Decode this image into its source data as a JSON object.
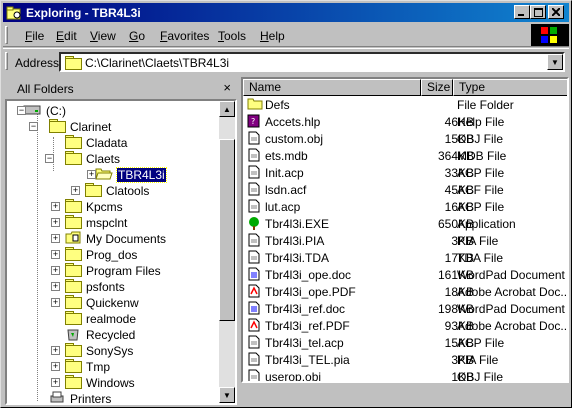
{
  "window": {
    "title": "Exploring - TBR4L3i"
  },
  "menu": [
    {
      "label": "File",
      "u": "F",
      "rest": "ile"
    },
    {
      "label": "Edit",
      "u": "E",
      "rest": "dit"
    },
    {
      "label": "View",
      "u": "V",
      "rest": "iew"
    },
    {
      "label": "Go",
      "u": "G",
      "rest": "o"
    },
    {
      "label": "Favorites",
      "u": "F",
      "rest": "avorites"
    },
    {
      "label": "Tools",
      "u": "T",
      "rest": "ools"
    },
    {
      "label": "Help",
      "u": "H",
      "rest": "elp"
    }
  ],
  "address": {
    "label": "Address",
    "value": "C:\\Clarinet\\Claets\\TBR4L3i"
  },
  "left_pane": {
    "title": "All Folders",
    "close": "×",
    "tree": [
      {
        "label": "(C:)",
        "icon": "drive-icon"
      },
      {
        "label": "Clarinet",
        "icon": "folder-icon"
      },
      {
        "label": "Cladata",
        "icon": "folder-icon"
      },
      {
        "label": "Claets",
        "icon": "folder-icon"
      },
      {
        "label": "TBR4L3i",
        "icon": "folder-open-icon"
      },
      {
        "label": "Clatools",
        "icon": "folder-icon"
      },
      {
        "label": "Kpcms",
        "icon": "folder-icon"
      },
      {
        "label": "mspclnt",
        "icon": "folder-icon"
      },
      {
        "label": "My Documents",
        "icon": "documents-folder-icon"
      },
      {
        "label": "Prog_dos",
        "icon": "folder-icon"
      },
      {
        "label": "Program Files",
        "icon": "folder-icon"
      },
      {
        "label": "psfonts",
        "icon": "folder-icon"
      },
      {
        "label": "Quickenw",
        "icon": "folder-icon"
      },
      {
        "label": "realmode",
        "icon": "folder-icon"
      },
      {
        "label": "Recycled",
        "icon": "recycle-bin-icon"
      },
      {
        "label": "SonySys",
        "icon": "folder-icon"
      },
      {
        "label": "Tmp",
        "icon": "folder-icon"
      },
      {
        "label": "Windows",
        "icon": "folder-icon"
      },
      {
        "label": "Printers",
        "icon": "printer-icon"
      }
    ]
  },
  "columns": {
    "name": "Name",
    "size": "Size",
    "type": "Type"
  },
  "files": [
    {
      "name": "Defs",
      "size": "",
      "type": "File Folder",
      "icon": "folder-icon"
    },
    {
      "name": "Accets.hlp",
      "size": "46KB",
      "type": "Help File",
      "icon": "help-file-icon"
    },
    {
      "name": "custom.obj",
      "size": "15KB",
      "type": "OBJ File",
      "icon": "generic-file-icon"
    },
    {
      "name": "ets.mdb",
      "size": "364KB",
      "type": "MDB File",
      "icon": "generic-file-icon"
    },
    {
      "name": "Init.acp",
      "size": "33KB",
      "type": "ACP File",
      "icon": "generic-file-icon"
    },
    {
      "name": "lsdn.acf",
      "size": "45KB",
      "type": "ACF File",
      "icon": "generic-file-icon"
    },
    {
      "name": "lut.acp",
      "size": "16KB",
      "type": "ACP File",
      "icon": "generic-file-icon"
    },
    {
      "name": "Tbr4l3i.EXE",
      "size": "650KB",
      "type": "Application",
      "icon": "tree-app-icon"
    },
    {
      "name": "Tbr4l3i.PIA",
      "size": "3KB",
      "type": "PIA File",
      "icon": "generic-file-icon"
    },
    {
      "name": "Tbr4l3i.TDA",
      "size": "17KB",
      "type": "TDA File",
      "icon": "generic-file-icon"
    },
    {
      "name": "Tbr4l3i_ope.doc",
      "size": "161KB",
      "type": "WordPad Document",
      "icon": "wordpad-icon"
    },
    {
      "name": "Tbr4l3i_ope.PDF",
      "size": "18KB",
      "type": "Adobe Acrobat Doc...",
      "icon": "pdf-icon"
    },
    {
      "name": "Tbr4l3i_ref.doc",
      "size": "198KB",
      "type": "WordPad Document",
      "icon": "wordpad-icon"
    },
    {
      "name": "Tbr4l3i_ref.PDF",
      "size": "93KB",
      "type": "Adobe Acrobat Doc...",
      "icon": "pdf-icon"
    },
    {
      "name": "Tbr4l3i_tel.acp",
      "size": "15KB",
      "type": "ACP File",
      "icon": "generic-file-icon"
    },
    {
      "name": "Tbr4l3i_TEL.pia",
      "size": "3KB",
      "type": "PIA File",
      "icon": "generic-file-icon"
    },
    {
      "name": "userop.obj",
      "size": "1KB",
      "type": "OBJ File",
      "icon": "generic-file-icon"
    }
  ],
  "colors": {
    "titlebar": "#000080",
    "face": "#c0c0c0",
    "selection": "#000080"
  }
}
